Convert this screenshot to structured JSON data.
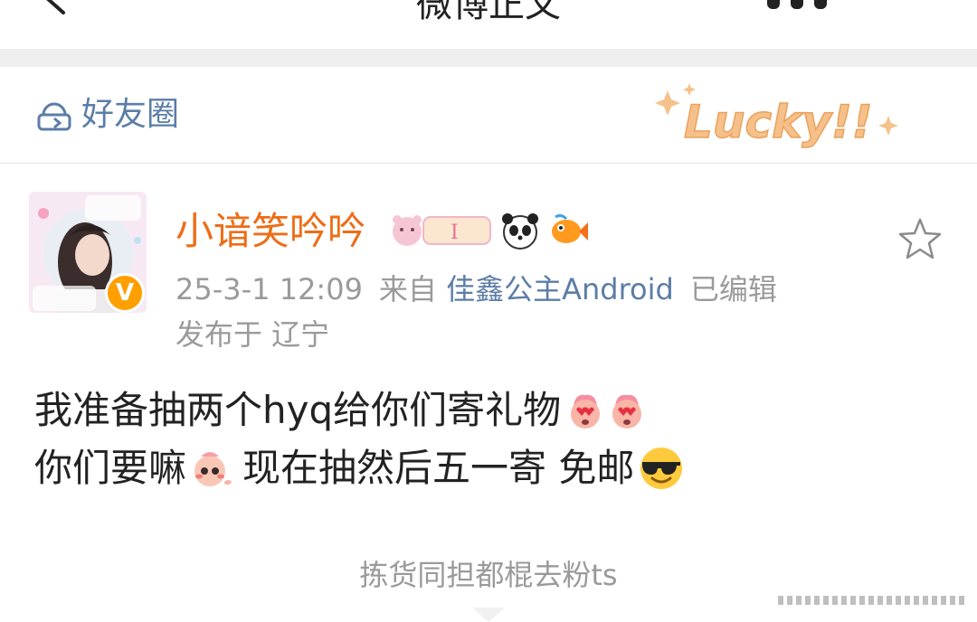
{
  "nav": {
    "title": "微博正文",
    "back_icon": "chevron-left-icon",
    "more_icon": "more-icon"
  },
  "circle": {
    "label": "好友圈",
    "icon": "friend-circle-icon",
    "decoration_text": "Lucky!!"
  },
  "post": {
    "username": "小谙笑吟吟",
    "verified_badge": "V",
    "timestamp": "25-3-1 12:09",
    "source_prefix": "来自",
    "source": "佳鑫公主Android",
    "edited": "已编辑",
    "location": "发布于 辽宁",
    "content": {
      "line1": "我准备抽两个hyq给你们寄礼物",
      "line2_a": "你们要嘛",
      "line2_b": "现在抽然后五一寄 免邮"
    },
    "favorite_icon": "star-outline-icon"
  },
  "footer": {
    "text": "拣货同担都棍去粉ts"
  },
  "colors": {
    "username": "#ed6d16",
    "link": "#5b7da7",
    "meta": "#9a9a9a",
    "text": "#222222",
    "badge": "#ff9f00"
  }
}
